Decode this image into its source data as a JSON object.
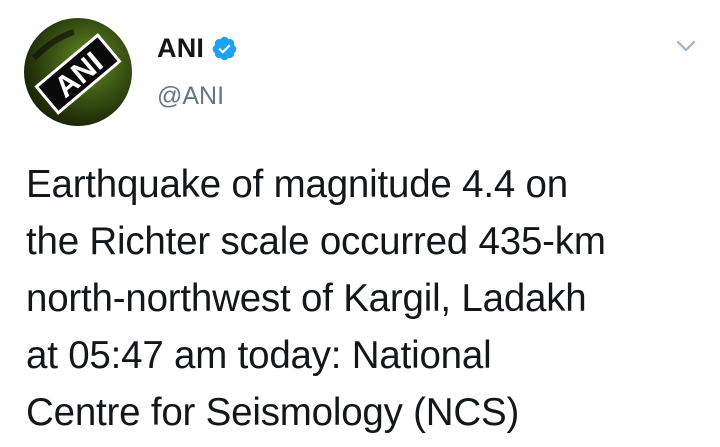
{
  "tweet": {
    "author": {
      "name": "ANI",
      "handle": "@ANI",
      "verified": true,
      "avatar_text": "ANI"
    },
    "text_lines": [
      "Earthquake of magnitude 4.4 on",
      "the Richter scale occurred 435-km",
      "north-northwest of Kargil, Ladakh",
      "at 05:47 am today: National",
      "Centre for Seismology (NCS)"
    ]
  },
  "icons": {
    "verified": "verified-badge-icon",
    "menu": "chevron-down-icon"
  },
  "colors": {
    "verified_blue": "#1da1f2",
    "handle_gray": "#657786",
    "text": "#14171a",
    "caret_gray": "#aab8c2"
  }
}
